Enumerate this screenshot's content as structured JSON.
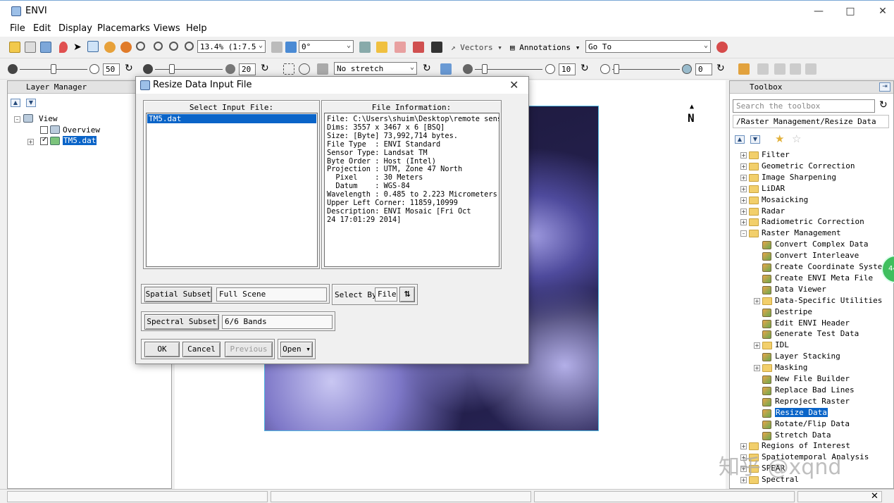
{
  "window": {
    "title": "ENVI"
  },
  "menu": [
    "File",
    "Edit",
    "Display",
    "Placemarks",
    "Views",
    "Help"
  ],
  "toolbar1": {
    "zoom": "13.4% (1:7.5",
    "rotation": "0°",
    "vectors_label": "Vectors",
    "annotations_label": "Annotations",
    "goto_label": "Go To"
  },
  "toolbar2": {
    "brightness": "50",
    "contrast": "20",
    "stretch": "No stretch",
    "sharpen": "10",
    "transparency": "0"
  },
  "layer_manager": {
    "title": "Layer Manager",
    "view_label": "View",
    "overview_label": "Overview",
    "file_label": "TM5.dat"
  },
  "toolbox": {
    "title": "Toolbox",
    "search_placeholder": "Search the toolbox",
    "path": "/Raster Management/Resize Data",
    "top_items": [
      "Filter",
      "Geometric Correction",
      "Image Sharpening",
      "LiDAR",
      "Mosaicking",
      "Radar",
      "Radiometric Correction",
      "Raster Management"
    ],
    "raster_items": [
      {
        "label": "Convert Complex Data",
        "type": "tool"
      },
      {
        "label": "Convert Interleave",
        "type": "tool"
      },
      {
        "label": "Create Coordinate System",
        "type": "tool"
      },
      {
        "label": "Create ENVI Meta File",
        "type": "tool"
      },
      {
        "label": "Data Viewer",
        "type": "tool"
      },
      {
        "label": "Data-Specific Utilities",
        "type": "folder"
      },
      {
        "label": "Destripe",
        "type": "tool"
      },
      {
        "label": "Edit ENVI Header",
        "type": "tool"
      },
      {
        "label": "Generate Test Data",
        "type": "tool"
      },
      {
        "label": "IDL",
        "type": "folder"
      },
      {
        "label": "Layer Stacking",
        "type": "tool"
      },
      {
        "label": "Masking",
        "type": "folder"
      },
      {
        "label": "New File Builder",
        "type": "tool"
      },
      {
        "label": "Replace Bad Lines",
        "type": "tool"
      },
      {
        "label": "Reproject Raster",
        "type": "tool"
      },
      {
        "label": "Resize Data",
        "type": "tool",
        "selected": true
      },
      {
        "label": "Rotate/Flip Data",
        "type": "tool"
      },
      {
        "label": "Stretch Data",
        "type": "tool"
      }
    ],
    "bottom_items": [
      "Regions of Interest",
      "Spatiotemporal Analysis",
      "SPEAR",
      "Spectral"
    ]
  },
  "map": {
    "north_label": "N"
  },
  "dialog": {
    "title": "Resize Data Input File",
    "select_input_label": "Select Input File:",
    "file_info_label": "File Information:",
    "files": [
      "TM5.dat"
    ],
    "file_info_lines": [
      "File: C:\\Users\\shuim\\Desktop\\remote sensi",
      "Dims: 3557 x 3467 x 6 [BSQ]",
      "Size: [Byte] 73,992,714 bytes.",
      "File Type  : ENVI Standard",
      "Sensor Type: Landsat TM",
      "Byte Order : Host (Intel)",
      "Projection : UTM, Zone 47 North",
      "  Pixel    : 30 Meters",
      "  Datum    : WGS-84",
      "Wavelength : 0.485 to 2.223 Micrometers",
      "Upper Left Corner: 11859,10999",
      "Description: ENVI Mosaic [Fri Oct",
      "24 17:01:29 2014]"
    ],
    "spatial_subset_label": "Spatial Subset",
    "spatial_subset_value": "Full Scene",
    "select_by_label": "Select By",
    "select_by_value": "File",
    "spectral_subset_label": "Spectral Subset",
    "spectral_subset_value": "6/6 Bands",
    "ok_label": "OK",
    "cancel_label": "Cancel",
    "previous_label": "Previous",
    "open_label": "Open"
  },
  "watermark": "知乎 @xqnd",
  "colors": {
    "selection": "#0a64c8",
    "folder": "#f2cf6b"
  }
}
